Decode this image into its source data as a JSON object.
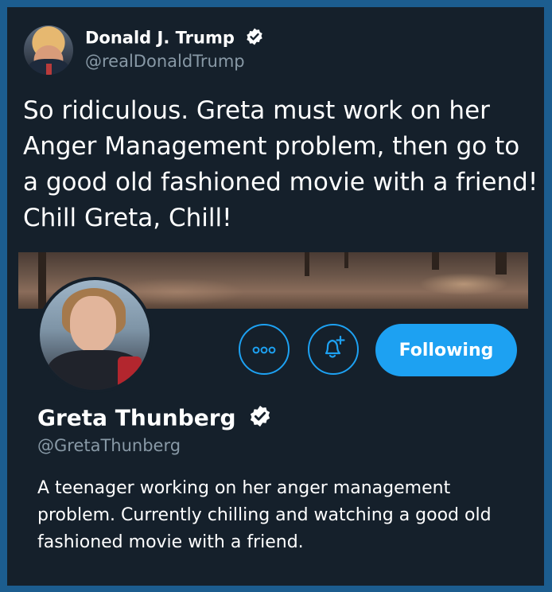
{
  "tweet": {
    "author_name": "Donald J. Trump",
    "author_handle": "@realDonaldTrump",
    "text": "So ridiculous. Greta must work on her Anger Management problem, then go to a good old fashioned movie with a friend! Chill Greta, Chill!"
  },
  "profile_card": {
    "name": "Greta Thunberg",
    "handle": "@GretaThunberg",
    "bio": "A teenager working on her anger management problem. Currently chilling and watching a good old fashioned movie with a friend.",
    "follow_label": "Following",
    "more_icon": "more-icon",
    "notification_icon": "bell-plus-icon"
  },
  "colors": {
    "background": "#15202b",
    "frame": "#1c5d8f",
    "accent": "#1da1f2",
    "secondary_text": "#8899a6"
  }
}
